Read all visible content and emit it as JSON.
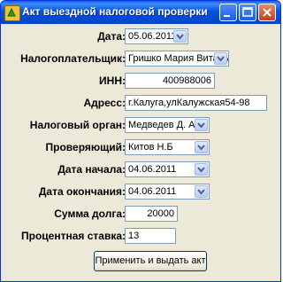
{
  "window": {
    "title": "Акт выездной налоговой проверки"
  },
  "form": {
    "date": {
      "label": "Дата:",
      "value": "05.06.2011"
    },
    "taxpayer": {
      "label": "Налогоплательщик:",
      "value": "Гришко Мария Витальевна"
    },
    "inn": {
      "label": "ИНН:",
      "value": "400988006"
    },
    "address": {
      "label": "Адресс:",
      "value": "г.Калуга,улКалужская54-98"
    },
    "tax_office": {
      "label": "Налоговый орган:",
      "value": "Медведев Д. А."
    },
    "inspector": {
      "label": "Проверяющий:",
      "value": "Китов Н.Б"
    },
    "start_date": {
      "label": "Дата начала:",
      "value": "04.06.2011"
    },
    "end_date": {
      "label": "Дата окончания:",
      "value": "04.06.2011"
    },
    "debt": {
      "label": "Сумма долга:",
      "value": "20000"
    },
    "rate": {
      "label": "Процентная ставка:",
      "value": "13"
    }
  },
  "actions": {
    "apply_label": "Применить и выдать акт"
  }
}
